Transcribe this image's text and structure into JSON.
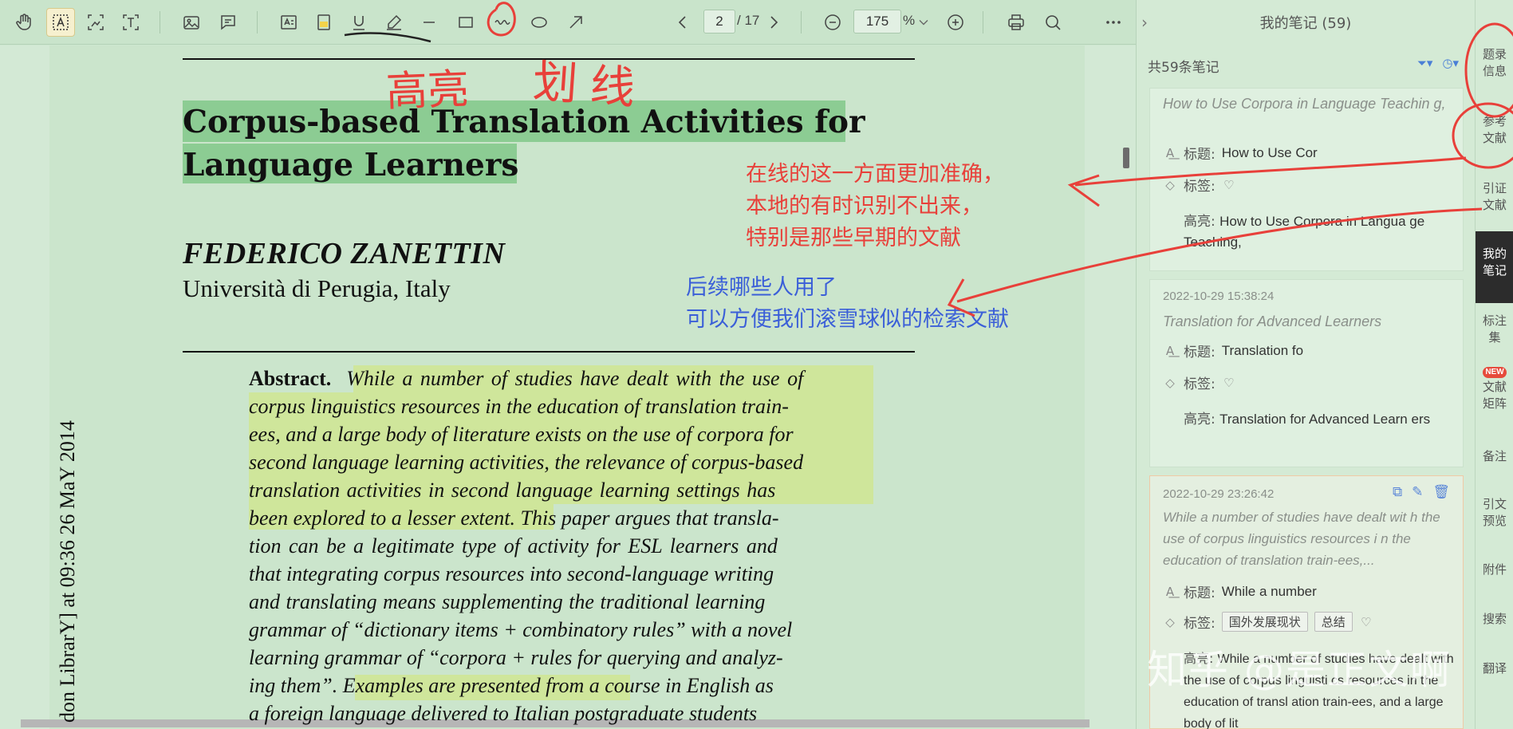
{
  "toolbar": {
    "page_current": "2",
    "page_total": "/ 17",
    "zoom_value": "175",
    "zoom_unit": "%"
  },
  "document": {
    "title_line1": "Corpus-based Translation Activities for",
    "title_line2": "Language Learners",
    "author": "FEDERICO ZANETTIN",
    "affiliation": "Università di Perugia, Italy",
    "side_text": "don LibrarY] at 09:36 26 MaY 2014",
    "abstract_label": "Abstract.",
    "abstract_lines": [
      "While a number of studies have dealt with the use of",
      "corpus linguistics resources in the education of translation train-",
      "ees, and a large body of literature exists on the use of corpora for",
      "second language learning activities, the relevance of corpus-based",
      "translation activities in second language learning settings has",
      "been explored to a lesser extent. This paper argues that transla-",
      "tion can be a legitimate type of activity for ESL learners and",
      "that integrating corpus resources into second-language writing",
      "and translating means supplementing the traditional learning",
      "grammar of “dictionary items + combinatory rules” with a novel",
      "learning grammar of “corpora + rules for querying and analyz-",
      "ing them”. Examples are presented from a course in English as",
      "a foreign language delivered to Italian postgraduate students"
    ]
  },
  "annotations": {
    "hw_highlight": "高亮",
    "hw_underline": "划线",
    "red_note": [
      "在线的这一方面更加准确，",
      "本地的有时识别不出来，",
      "特别是那些早期的文献"
    ],
    "blue_note": [
      "后续哪些人用了",
      "可以方便我们滚雪球似的检索文献"
    ]
  },
  "panel": {
    "title": "我的笔记 (59)",
    "subtitle": "共59条笔记",
    "label_title": "标题:",
    "label_tags": "标签:",
    "label_highlight": "高亮:",
    "cards": [
      {
        "source": "How to Use Corpora in Language Teachin g,",
        "title": "How to Use Cor",
        "highlight": "How to Use Corpora in Langua ge Teaching,"
      },
      {
        "date": "2022-10-29 15:38:24",
        "source": "Translation for Advanced Learners",
        "title": "Translation fo",
        "highlight": "Translation for Advanced Learn ers"
      },
      {
        "date": "2022-10-29 23:26:42",
        "source": "While a number of studies have dealt wit h the use of corpus linguistics resources i n the education of translation train-ees,...",
        "title": "While a number",
        "tags": [
          "国外发展现状",
          "总结"
        ],
        "highlight": "While a number of studies have dealt with the use of corpus linguisti cs resources in the education of transl ation train-ees, and a large body of lit"
      }
    ]
  },
  "rail": [
    {
      "label": "题录\n信息"
    },
    {
      "label": "参考\n文献"
    },
    {
      "label": "引证\n文献"
    },
    {
      "label": "我的\n笔记",
      "active": true
    },
    {
      "label": "标注\n集"
    },
    {
      "label": "文献\n矩阵",
      "badge": "NEW"
    },
    {
      "label": "备注"
    },
    {
      "label": "引文\n预览"
    },
    {
      "label": "附件"
    },
    {
      "label": "搜索"
    },
    {
      "label": "翻译"
    }
  ],
  "watermark": "知乎 @是正文啊",
  "colors": {
    "page_bg": "#cbe5cc",
    "title_highlight": "#8ccc93",
    "abstract_highlight": "#cfe69b",
    "annotation_red": "#e8403a",
    "annotation_blue": "#3b5fd8",
    "rail_active": "#2c2c2c"
  }
}
